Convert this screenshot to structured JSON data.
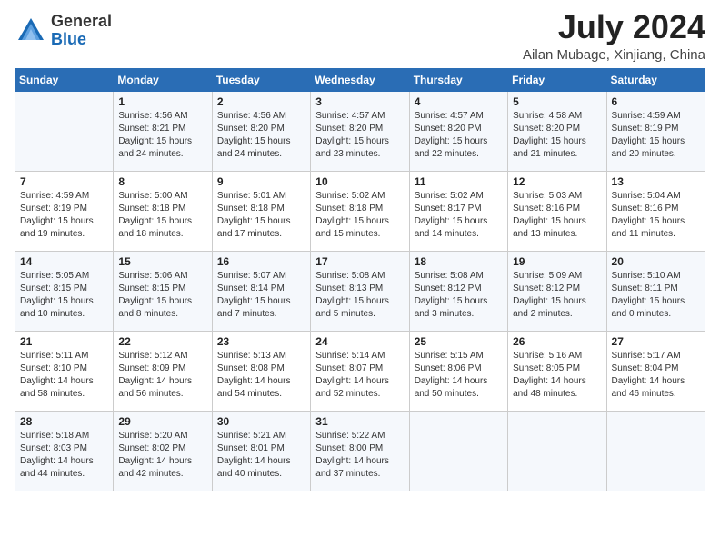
{
  "header": {
    "logo": {
      "general": "General",
      "blue": "Blue"
    },
    "title": "July 2024",
    "location": "Ailan Mubage, Xinjiang, China"
  },
  "days_of_week": [
    "Sunday",
    "Monday",
    "Tuesday",
    "Wednesday",
    "Thursday",
    "Friday",
    "Saturday"
  ],
  "weeks": [
    [
      {
        "day": "",
        "sunrise": "",
        "sunset": "",
        "daylight": ""
      },
      {
        "day": "1",
        "sunrise": "Sunrise: 4:56 AM",
        "sunset": "Sunset: 8:21 PM",
        "daylight": "Daylight: 15 hours and 24 minutes."
      },
      {
        "day": "2",
        "sunrise": "Sunrise: 4:56 AM",
        "sunset": "Sunset: 8:20 PM",
        "daylight": "Daylight: 15 hours and 24 minutes."
      },
      {
        "day": "3",
        "sunrise": "Sunrise: 4:57 AM",
        "sunset": "Sunset: 8:20 PM",
        "daylight": "Daylight: 15 hours and 23 minutes."
      },
      {
        "day": "4",
        "sunrise": "Sunrise: 4:57 AM",
        "sunset": "Sunset: 8:20 PM",
        "daylight": "Daylight: 15 hours and 22 minutes."
      },
      {
        "day": "5",
        "sunrise": "Sunrise: 4:58 AM",
        "sunset": "Sunset: 8:20 PM",
        "daylight": "Daylight: 15 hours and 21 minutes."
      },
      {
        "day": "6",
        "sunrise": "Sunrise: 4:59 AM",
        "sunset": "Sunset: 8:19 PM",
        "daylight": "Daylight: 15 hours and 20 minutes."
      }
    ],
    [
      {
        "day": "7",
        "sunrise": "Sunrise: 4:59 AM",
        "sunset": "Sunset: 8:19 PM",
        "daylight": "Daylight: 15 hours and 19 minutes."
      },
      {
        "day": "8",
        "sunrise": "Sunrise: 5:00 AM",
        "sunset": "Sunset: 8:18 PM",
        "daylight": "Daylight: 15 hours and 18 minutes."
      },
      {
        "day": "9",
        "sunrise": "Sunrise: 5:01 AM",
        "sunset": "Sunset: 8:18 PM",
        "daylight": "Daylight: 15 hours and 17 minutes."
      },
      {
        "day": "10",
        "sunrise": "Sunrise: 5:02 AM",
        "sunset": "Sunset: 8:18 PM",
        "daylight": "Daylight: 15 hours and 15 minutes."
      },
      {
        "day": "11",
        "sunrise": "Sunrise: 5:02 AM",
        "sunset": "Sunset: 8:17 PM",
        "daylight": "Daylight: 15 hours and 14 minutes."
      },
      {
        "day": "12",
        "sunrise": "Sunrise: 5:03 AM",
        "sunset": "Sunset: 8:16 PM",
        "daylight": "Daylight: 15 hours and 13 minutes."
      },
      {
        "day": "13",
        "sunrise": "Sunrise: 5:04 AM",
        "sunset": "Sunset: 8:16 PM",
        "daylight": "Daylight: 15 hours and 11 minutes."
      }
    ],
    [
      {
        "day": "14",
        "sunrise": "Sunrise: 5:05 AM",
        "sunset": "Sunset: 8:15 PM",
        "daylight": "Daylight: 15 hours and 10 minutes."
      },
      {
        "day": "15",
        "sunrise": "Sunrise: 5:06 AM",
        "sunset": "Sunset: 8:15 PM",
        "daylight": "Daylight: 15 hours and 8 minutes."
      },
      {
        "day": "16",
        "sunrise": "Sunrise: 5:07 AM",
        "sunset": "Sunset: 8:14 PM",
        "daylight": "Daylight: 15 hours and 7 minutes."
      },
      {
        "day": "17",
        "sunrise": "Sunrise: 5:08 AM",
        "sunset": "Sunset: 8:13 PM",
        "daylight": "Daylight: 15 hours and 5 minutes."
      },
      {
        "day": "18",
        "sunrise": "Sunrise: 5:08 AM",
        "sunset": "Sunset: 8:12 PM",
        "daylight": "Daylight: 15 hours and 3 minutes."
      },
      {
        "day": "19",
        "sunrise": "Sunrise: 5:09 AM",
        "sunset": "Sunset: 8:12 PM",
        "daylight": "Daylight: 15 hours and 2 minutes."
      },
      {
        "day": "20",
        "sunrise": "Sunrise: 5:10 AM",
        "sunset": "Sunset: 8:11 PM",
        "daylight": "Daylight: 15 hours and 0 minutes."
      }
    ],
    [
      {
        "day": "21",
        "sunrise": "Sunrise: 5:11 AM",
        "sunset": "Sunset: 8:10 PM",
        "daylight": "Daylight: 14 hours and 58 minutes."
      },
      {
        "day": "22",
        "sunrise": "Sunrise: 5:12 AM",
        "sunset": "Sunset: 8:09 PM",
        "daylight": "Daylight: 14 hours and 56 minutes."
      },
      {
        "day": "23",
        "sunrise": "Sunrise: 5:13 AM",
        "sunset": "Sunset: 8:08 PM",
        "daylight": "Daylight: 14 hours and 54 minutes."
      },
      {
        "day": "24",
        "sunrise": "Sunrise: 5:14 AM",
        "sunset": "Sunset: 8:07 PM",
        "daylight": "Daylight: 14 hours and 52 minutes."
      },
      {
        "day": "25",
        "sunrise": "Sunrise: 5:15 AM",
        "sunset": "Sunset: 8:06 PM",
        "daylight": "Daylight: 14 hours and 50 minutes."
      },
      {
        "day": "26",
        "sunrise": "Sunrise: 5:16 AM",
        "sunset": "Sunset: 8:05 PM",
        "daylight": "Daylight: 14 hours and 48 minutes."
      },
      {
        "day": "27",
        "sunrise": "Sunrise: 5:17 AM",
        "sunset": "Sunset: 8:04 PM",
        "daylight": "Daylight: 14 hours and 46 minutes."
      }
    ],
    [
      {
        "day": "28",
        "sunrise": "Sunrise: 5:18 AM",
        "sunset": "Sunset: 8:03 PM",
        "daylight": "Daylight: 14 hours and 44 minutes."
      },
      {
        "day": "29",
        "sunrise": "Sunrise: 5:20 AM",
        "sunset": "Sunset: 8:02 PM",
        "daylight": "Daylight: 14 hours and 42 minutes."
      },
      {
        "day": "30",
        "sunrise": "Sunrise: 5:21 AM",
        "sunset": "Sunset: 8:01 PM",
        "daylight": "Daylight: 14 hours and 40 minutes."
      },
      {
        "day": "31",
        "sunrise": "Sunrise: 5:22 AM",
        "sunset": "Sunset: 8:00 PM",
        "daylight": "Daylight: 14 hours and 37 minutes."
      },
      {
        "day": "",
        "sunrise": "",
        "sunset": "",
        "daylight": ""
      },
      {
        "day": "",
        "sunrise": "",
        "sunset": "",
        "daylight": ""
      },
      {
        "day": "",
        "sunrise": "",
        "sunset": "",
        "daylight": ""
      }
    ]
  ]
}
